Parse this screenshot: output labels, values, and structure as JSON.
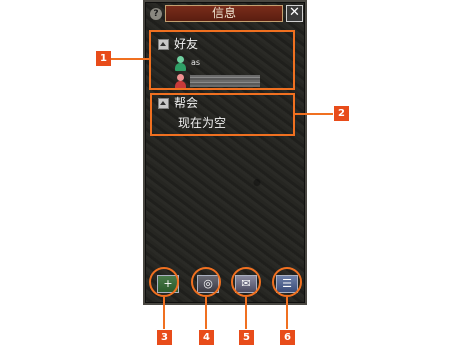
{
  "window": {
    "title": "信息",
    "help_glyph": "?",
    "close_glyph": "✕"
  },
  "friends_section": {
    "label": "好友",
    "members": [
      {
        "name": "as",
        "status": "online"
      },
      {
        "name": "",
        "status": "offline"
      }
    ]
  },
  "guild_section": {
    "label": "帮会",
    "status_text": "现在为空"
  },
  "toolbar": {
    "buttons": [
      {
        "icon": "add-friend-icon",
        "glyph": "+"
      },
      {
        "icon": "search-icon",
        "glyph": "◎"
      },
      {
        "icon": "mail-icon",
        "glyph": "✉"
      },
      {
        "icon": "list-icon",
        "glyph": "☰"
      }
    ]
  },
  "callouts": [
    "1",
    "2",
    "3",
    "4",
    "5",
    "6"
  ],
  "colors": {
    "annotation": "#f07020",
    "badge": "#e84c1a",
    "title_plate": "#6a2414",
    "online_icon": "#2f9f66",
    "offline_icon": "#c83a3a"
  }
}
